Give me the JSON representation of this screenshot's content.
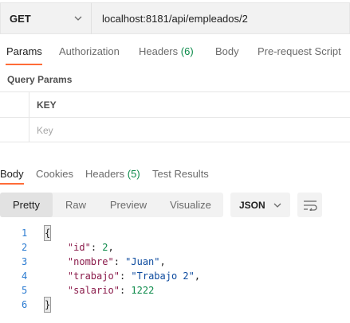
{
  "request": {
    "method": "GET",
    "url": "localhost:8181/api/empleados/2"
  },
  "request_tabs": {
    "params": "Params",
    "authorization": "Authorization",
    "headers": "Headers",
    "headers_count": "(6)",
    "body": "Body",
    "prerequest": "Pre-request Script"
  },
  "query_params": {
    "title": "Query Params",
    "key_header": "KEY",
    "key_placeholder": "Key"
  },
  "response_tabs": {
    "body": "Body",
    "cookies": "Cookies",
    "headers": "Headers",
    "headers_count": "(5)",
    "test_results": "Test Results"
  },
  "view": {
    "pretty": "Pretty",
    "raw": "Raw",
    "preview": "Preview",
    "visualize": "Visualize",
    "format": "JSON"
  },
  "response_body": {
    "lines": [
      {
        "n": "1",
        "open": "{"
      },
      {
        "n": "2",
        "key": "\"id\"",
        "value": "2",
        "vtype": "num",
        "comma": ","
      },
      {
        "n": "3",
        "key": "\"nombre\"",
        "value": "\"Juan\"",
        "vtype": "str",
        "comma": ","
      },
      {
        "n": "4",
        "key": "\"trabajo\"",
        "value": "\"Trabajo 2\"",
        "vtype": "str",
        "comma": ","
      },
      {
        "n": "5",
        "key": "\"salario\"",
        "value": "1222",
        "vtype": "num",
        "comma": ""
      },
      {
        "n": "6",
        "close": "}"
      }
    ]
  },
  "colors": {
    "accent": "#ff6c37",
    "count": "#0c8a4a",
    "line_number": "#2b7bd1",
    "json_key": "#8a1a4a",
    "json_string": "#0c4a9e",
    "json_number": "#0c8a4a"
  },
  "icons": {
    "method_dropdown": "chevron-down-icon",
    "format_dropdown": "chevron-down-icon",
    "wrap": "wrap-lines-icon"
  }
}
